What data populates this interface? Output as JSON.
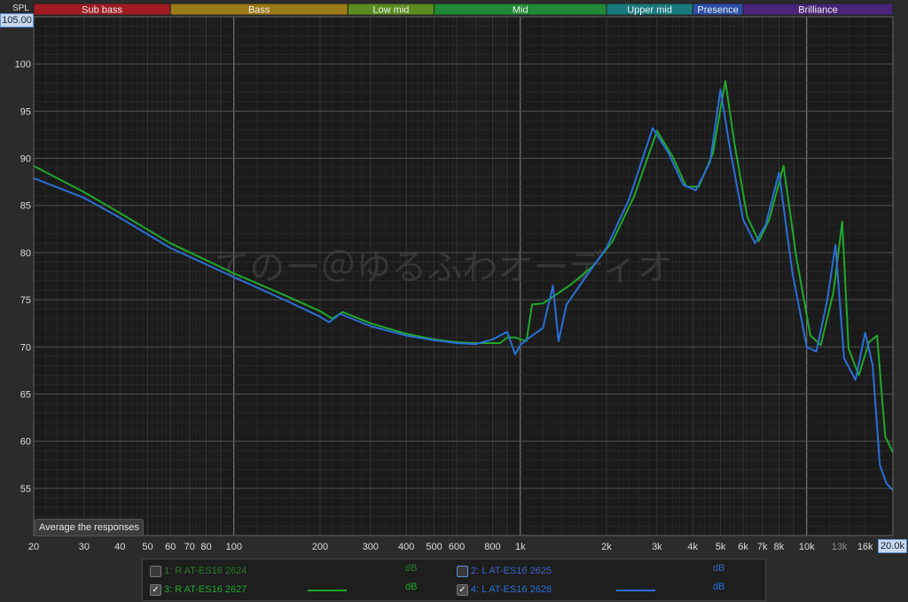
{
  "chart_data": {
    "type": "line",
    "x_scale": "log",
    "xlim": [
      20,
      20000
    ],
    "ylim": [
      50,
      105
    ],
    "ylabel": "SPL",
    "y_max_readout": "105.00",
    "x_max_readout": "20.0k",
    "grid": true,
    "watermark": "てのー＠ゆるふわオーディオ",
    "bands": [
      {
        "label": "Sub bass",
        "from": 20,
        "to": 60,
        "color": "#a01c24"
      },
      {
        "label": "Bass",
        "from": 60,
        "to": 250,
        "color": "#9c7a17"
      },
      {
        "label": "Low mid",
        "from": 250,
        "to": 500,
        "color": "#5b8c1f"
      },
      {
        "label": "Mid",
        "from": 500,
        "to": 2000,
        "color": "#1f8a33"
      },
      {
        "label": "Upper mid",
        "from": 2000,
        "to": 4000,
        "color": "#187a7c"
      },
      {
        "label": "Presence",
        "from": 4000,
        "to": 6000,
        "color": "#2c4ea6"
      },
      {
        "label": "Brilliance",
        "from": 6000,
        "to": 20000,
        "color": "#4a2478"
      }
    ],
    "y_ticks": [
      "55",
      "60",
      "65",
      "70",
      "75",
      "80",
      "85",
      "90",
      "95",
      "100"
    ],
    "x_ticks": [
      {
        "v": 20,
        "t": "20"
      },
      {
        "v": 30,
        "t": "30"
      },
      {
        "v": 40,
        "t": "40"
      },
      {
        "v": 50,
        "t": "50"
      },
      {
        "v": 60,
        "t": "60"
      },
      {
        "v": 70,
        "t": "70"
      },
      {
        "v": 80,
        "t": "80"
      },
      {
        "v": 100,
        "t": "100"
      },
      {
        "v": 200,
        "t": "200"
      },
      {
        "v": 300,
        "t": "300"
      },
      {
        "v": 400,
        "t": "400"
      },
      {
        "v": 500,
        "t": "500"
      },
      {
        "v": 600,
        "t": "600"
      },
      {
        "v": 800,
        "t": "800"
      },
      {
        "v": 1000,
        "t": "1k"
      },
      {
        "v": 2000,
        "t": "2k"
      },
      {
        "v": 3000,
        "t": "3k"
      },
      {
        "v": 4000,
        "t": "4k"
      },
      {
        "v": 5000,
        "t": "5k"
      },
      {
        "v": 6000,
        "t": "6k"
      },
      {
        "v": 7000,
        "t": "7k"
      },
      {
        "v": 8000,
        "t": "8k"
      },
      {
        "v": 10000,
        "t": "10k"
      },
      {
        "v": 13000,
        "t": "13k"
      },
      {
        "v": 16000,
        "t": "16k"
      }
    ],
    "series": [
      {
        "name": "3: R AT-ES16 2627",
        "color": "#1fa82a",
        "points": [
          [
            20,
            89.2
          ],
          [
            30,
            86.4
          ],
          [
            40,
            84.2
          ],
          [
            60,
            81.0
          ],
          [
            100,
            77.8
          ],
          [
            150,
            75.5
          ],
          [
            200,
            73.8
          ],
          [
            220,
            73.0
          ],
          [
            240,
            73.7
          ],
          [
            300,
            72.5
          ],
          [
            400,
            71.4
          ],
          [
            500,
            70.8
          ],
          [
            600,
            70.5
          ],
          [
            700,
            70.4
          ],
          [
            850,
            70.4
          ],
          [
            900,
            71.0
          ],
          [
            960,
            71.0
          ],
          [
            1050,
            70.6
          ],
          [
            1100,
            74.5
          ],
          [
            1200,
            74.6
          ],
          [
            1500,
            76.6
          ],
          [
            1800,
            78.6
          ],
          [
            2100,
            81.2
          ],
          [
            2500,
            86.0
          ],
          [
            3000,
            92.9
          ],
          [
            3400,
            90.2
          ],
          [
            3800,
            87.0
          ],
          [
            4200,
            87.0
          ],
          [
            4700,
            90.5
          ],
          [
            5200,
            98.2
          ],
          [
            5600,
            91.5
          ],
          [
            6200,
            83.8
          ],
          [
            6800,
            81.2
          ],
          [
            7400,
            83.5
          ],
          [
            8300,
            89.2
          ],
          [
            9200,
            79.5
          ],
          [
            10300,
            71.2
          ],
          [
            11200,
            70.2
          ],
          [
            12400,
            75.8
          ],
          [
            13300,
            83.3
          ],
          [
            14000,
            69.8
          ],
          [
            15200,
            67.0
          ],
          [
            16500,
            70.5
          ],
          [
            17600,
            71.2
          ],
          [
            18800,
            60.5
          ],
          [
            20000,
            58.8
          ]
        ]
      },
      {
        "name": "4: L AT-ES16 2628",
        "color": "#2a6fd6",
        "points": [
          [
            20,
            87.9
          ],
          [
            30,
            85.8
          ],
          [
            40,
            83.7
          ],
          [
            60,
            80.5
          ],
          [
            100,
            77.4
          ],
          [
            150,
            75.0
          ],
          [
            200,
            73.2
          ],
          [
            215,
            72.6
          ],
          [
            235,
            73.5
          ],
          [
            300,
            72.2
          ],
          [
            400,
            71.2
          ],
          [
            500,
            70.7
          ],
          [
            600,
            70.4
          ],
          [
            700,
            70.3
          ],
          [
            800,
            70.8
          ],
          [
            900,
            71.6
          ],
          [
            960,
            69.2
          ],
          [
            1000,
            70.2
          ],
          [
            1100,
            71.2
          ],
          [
            1200,
            72.0
          ],
          [
            1300,
            76.5
          ],
          [
            1360,
            70.6
          ],
          [
            1450,
            74.5
          ],
          [
            1700,
            77.5
          ],
          [
            2000,
            80.5
          ],
          [
            2400,
            85.7
          ],
          [
            2900,
            93.2
          ],
          [
            3300,
            90.5
          ],
          [
            3700,
            87.2
          ],
          [
            4100,
            86.6
          ],
          [
            4600,
            89.6
          ],
          [
            5000,
            97.3
          ],
          [
            5400,
            91.0
          ],
          [
            6000,
            83.5
          ],
          [
            6600,
            81.0
          ],
          [
            7200,
            83.0
          ],
          [
            8000,
            88.5
          ],
          [
            8900,
            78.0
          ],
          [
            10000,
            70.0
          ],
          [
            10800,
            69.5
          ],
          [
            11800,
            75.0
          ],
          [
            12600,
            80.8
          ],
          [
            13500,
            68.8
          ],
          [
            14800,
            66.5
          ],
          [
            16000,
            71.5
          ],
          [
            17000,
            68.0
          ],
          [
            18000,
            57.5
          ],
          [
            19000,
            55.5
          ],
          [
            20000,
            54.8
          ]
        ]
      }
    ]
  },
  "controls": {
    "average_button": "Average the responses"
  },
  "legend": [
    {
      "label": "1: R AT-ES16 2624",
      "unit": "dB",
      "checked": false,
      "color": "#2a7a2a",
      "line": false
    },
    {
      "label": "2: L AT-ES16 2625",
      "unit": "dB",
      "checked": false,
      "color": "#3d63c8",
      "line": false
    },
    {
      "label": "3: R AT-ES16 2627",
      "unit": "dB",
      "checked": true,
      "color": "#1fa82a",
      "line": true
    },
    {
      "label": "4: L AT-ES16 2628",
      "unit": "dB",
      "checked": true,
      "color": "#2a6fd6",
      "line": true
    }
  ]
}
